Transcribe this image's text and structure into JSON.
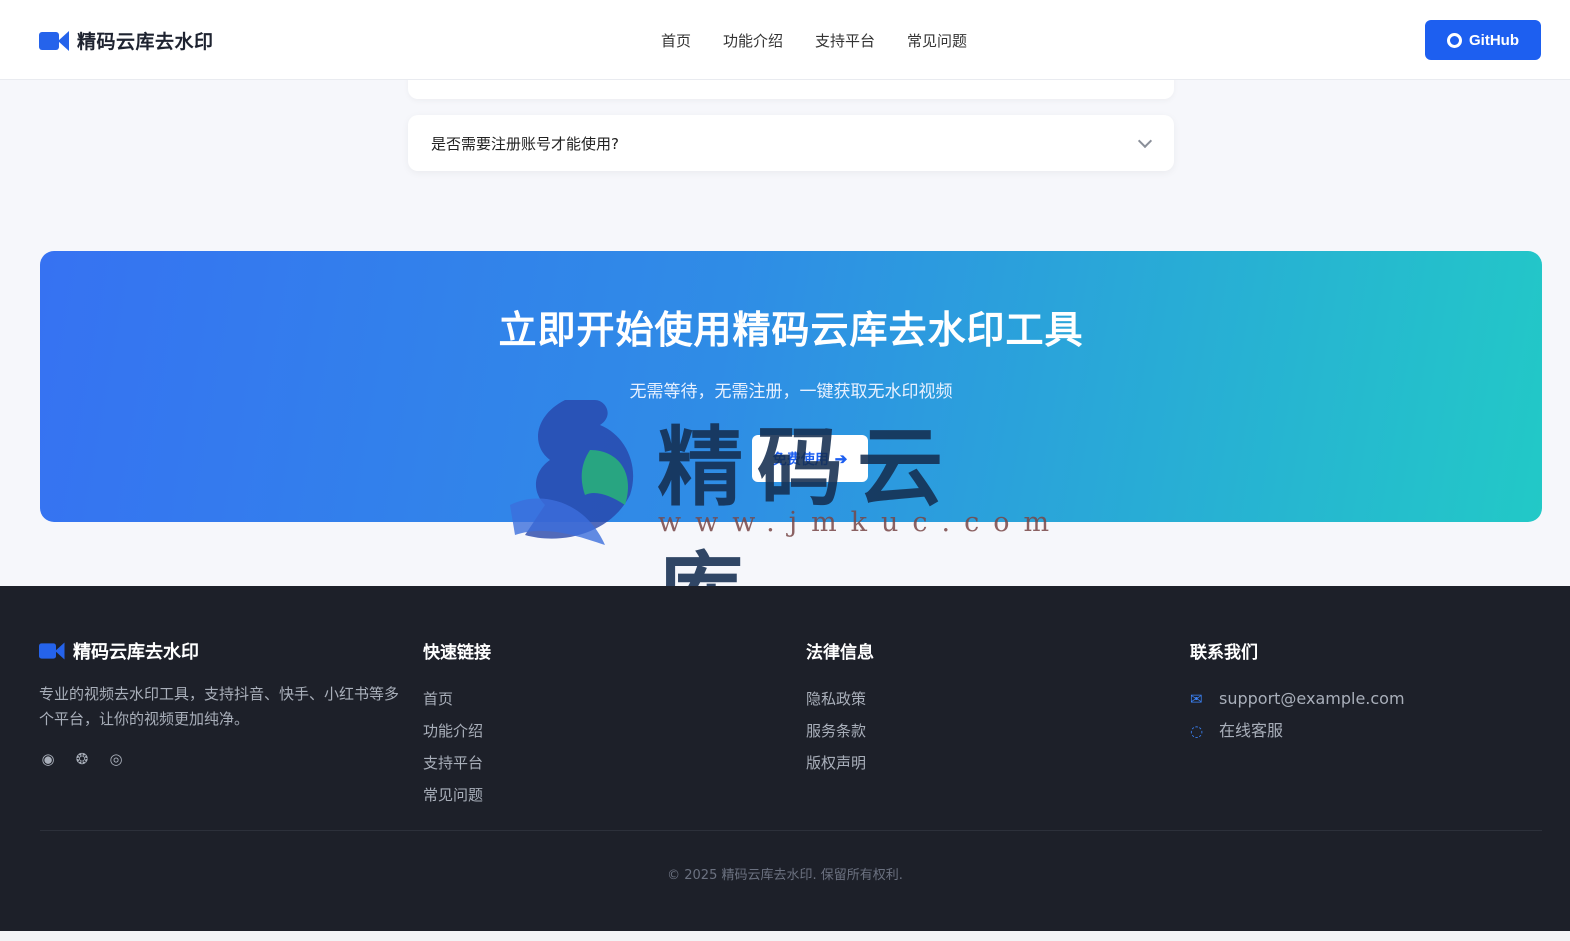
{
  "header": {
    "brand": "精码云库去水印",
    "nav": [
      "首页",
      "功能介绍",
      "支持平台",
      "常见问题"
    ],
    "github_label": "GitHub"
  },
  "faq": {
    "question": "是否需要注册账号才能使用?"
  },
  "cta": {
    "title": "立即开始使用精码云库去水印工具",
    "subtitle": "无需等待，无需注册，一键获取无水印视频",
    "button_label": "免费使用"
  },
  "watermark": {
    "text": "精码云库",
    "url": "www.jmkuc.com"
  },
  "footer": {
    "brand": "精码云库去水印",
    "description": "专业的视频去水印工具，支持抖音、快手、小红书等多个平台，让你的视频更加纯净。",
    "social_icons": [
      "weibo-icon",
      "wechat-icon",
      "github-icon"
    ],
    "quick_links": {
      "title": "快速链接",
      "items": [
        "首页",
        "功能介绍",
        "支持平台",
        "常见问题"
      ]
    },
    "legal": {
      "title": "法律信息",
      "items": [
        "隐私政策",
        "服务条款",
        "版权声明"
      ]
    },
    "contact": {
      "title": "联系我们",
      "email": "support@example.com",
      "chat": "在线客服"
    },
    "copyright": "© 2025 精码云库去水印. 保留所有权利."
  },
  "colors": {
    "primary": "#1d5ff0",
    "footer_bg": "#1d2029",
    "gradient_start": "#3672f2",
    "gradient_end": "#22c9c7"
  }
}
